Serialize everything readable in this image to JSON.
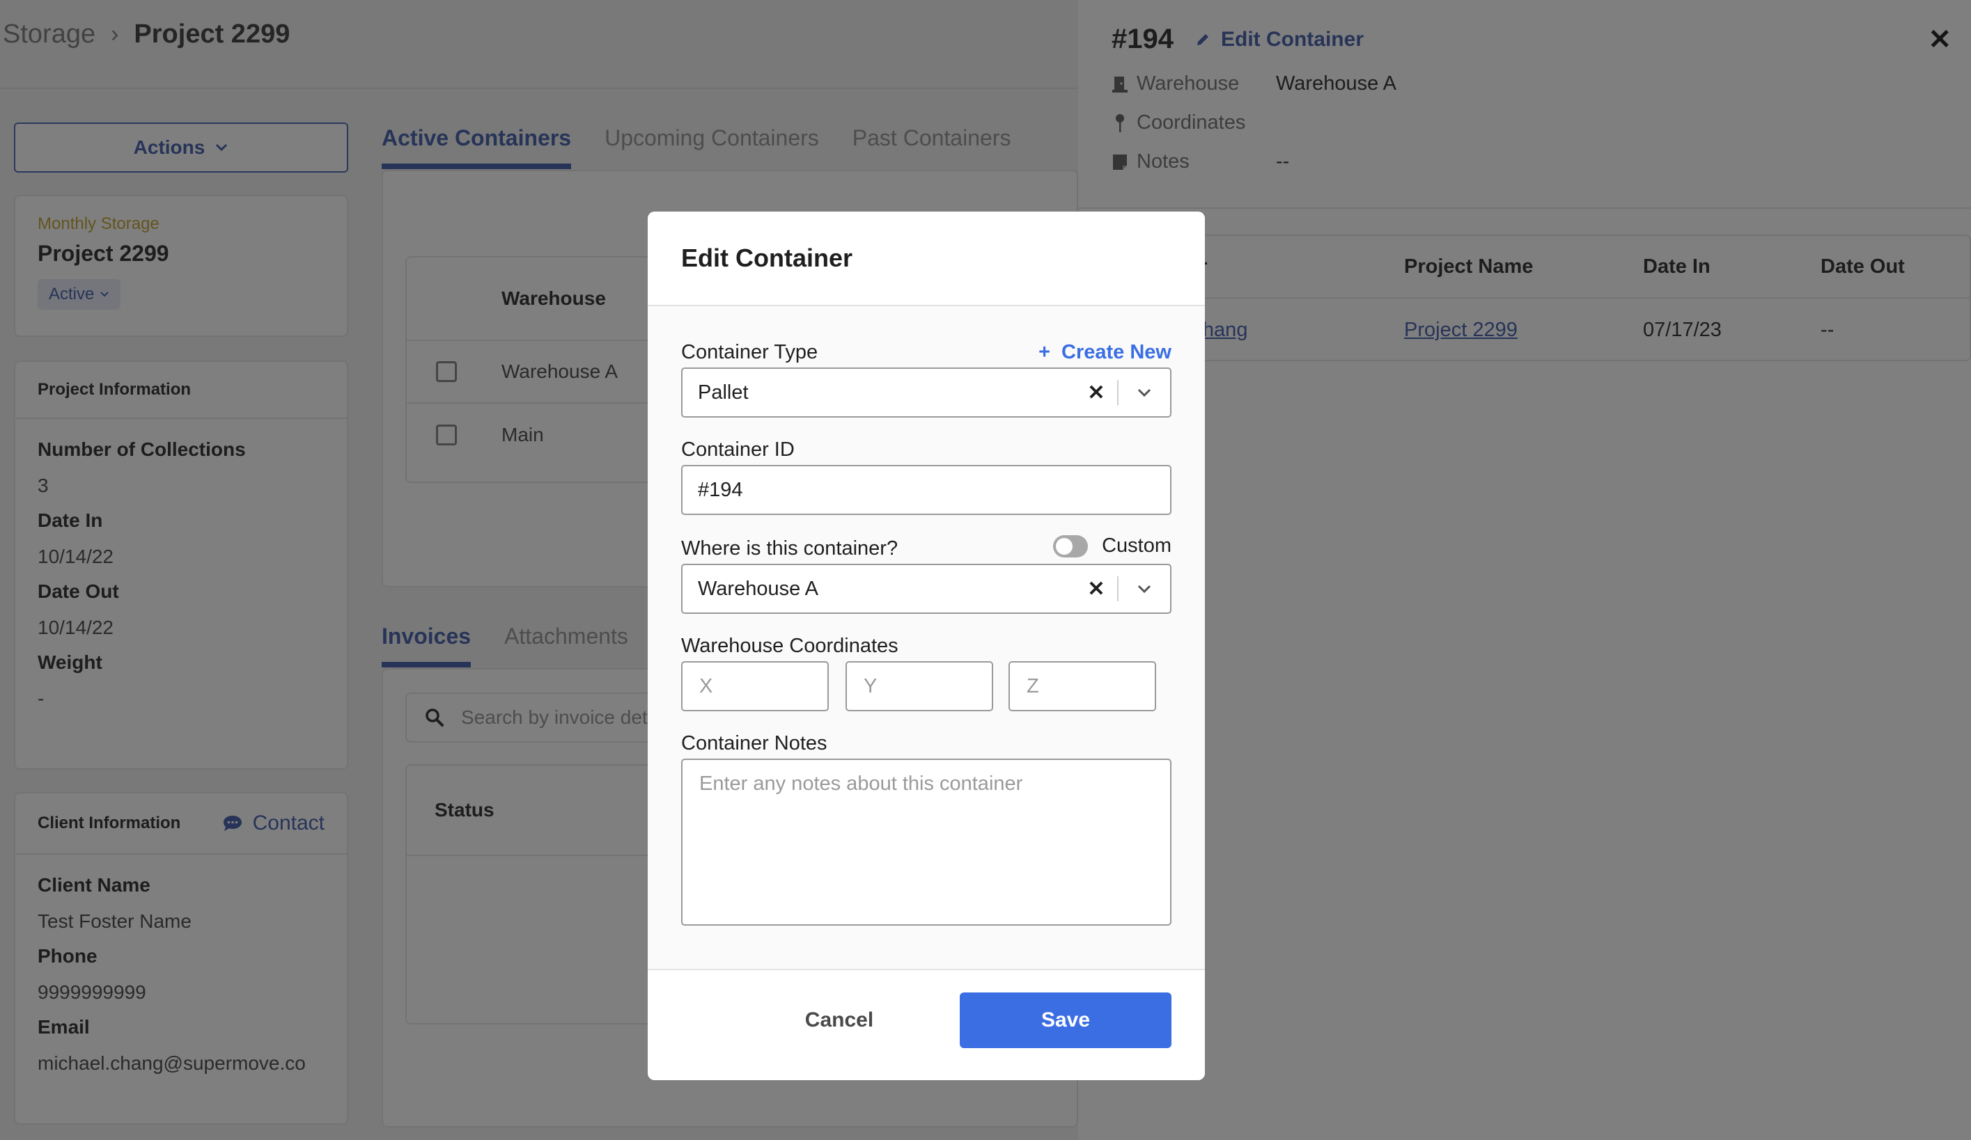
{
  "breadcrumb": {
    "root": "Storage",
    "separator": "›",
    "current": "Project 2299"
  },
  "actions": {
    "label": "Actions"
  },
  "project_card": {
    "type": "Monthly Storage",
    "name": "Project 2299",
    "status": "Active"
  },
  "project_info": {
    "title": "Project Information",
    "fields": [
      {
        "label": "Number of Collections",
        "value": "3"
      },
      {
        "label": "Date In",
        "value": "10/14/22"
      },
      {
        "label": "Date Out",
        "value": "10/14/22"
      },
      {
        "label": "Weight",
        "value": "-"
      }
    ]
  },
  "client_info": {
    "title": "Client Information",
    "contact_label": "Contact",
    "fields": [
      {
        "label": "Client Name",
        "value": "Test Foster Name"
      },
      {
        "label": "Phone",
        "value": "9999999999"
      },
      {
        "label": "Email",
        "value": "michael.chang@supermove.co"
      }
    ]
  },
  "container_tabs": [
    {
      "label": "Active Containers",
      "active": true
    },
    {
      "label": "Upcoming Containers",
      "active": false
    },
    {
      "label": "Past Containers",
      "active": false
    }
  ],
  "containers_table": {
    "header": "Warehouse",
    "rows": [
      {
        "warehouse": "Warehouse A"
      },
      {
        "warehouse": "Main"
      }
    ]
  },
  "bottom_tabs": [
    {
      "label": "Invoices",
      "active": true
    },
    {
      "label": "Attachments",
      "active": false
    }
  ],
  "invoice_search": {
    "placeholder": "Search by invoice details"
  },
  "invoice_table": {
    "header": "Status"
  },
  "drawer": {
    "container_id": "#194",
    "edit_label": "Edit Container",
    "rows": [
      {
        "icon": "warehouse-door-icon",
        "label": "Warehouse",
        "value": "Warehouse A"
      },
      {
        "icon": "map-pin-icon",
        "label": "Coordinates",
        "value": ""
      },
      {
        "icon": "note-icon",
        "label": "Notes",
        "value": "--"
      }
    ],
    "table": {
      "headers": [
        "Customer",
        "Project Name",
        "Date In",
        "Date Out"
      ],
      "rows": [
        {
          "customer": "Michael Chang",
          "project": "Project 2299",
          "date_in": "07/17/23",
          "date_out": "--"
        }
      ]
    }
  },
  "modal": {
    "title": "Edit Container",
    "container_type": {
      "label": "Container Type",
      "value": "Pallet",
      "create_new": "Create New"
    },
    "container_id": {
      "label": "Container ID",
      "value": "#194"
    },
    "location": {
      "label": "Where is this container?",
      "value": "Warehouse A",
      "custom_label": "Custom",
      "custom_on": false
    },
    "coordinates": {
      "label": "Warehouse Coordinates",
      "x_placeholder": "X",
      "y_placeholder": "Y",
      "z_placeholder": "Z"
    },
    "notes": {
      "label": "Container Notes",
      "placeholder": "Enter any notes about this container"
    },
    "cancel_label": "Cancel",
    "save_label": "Save"
  },
  "colors": {
    "primary": "#3b6ee3",
    "link": "#4f68b0",
    "accent_gold": "#c7a93f"
  }
}
